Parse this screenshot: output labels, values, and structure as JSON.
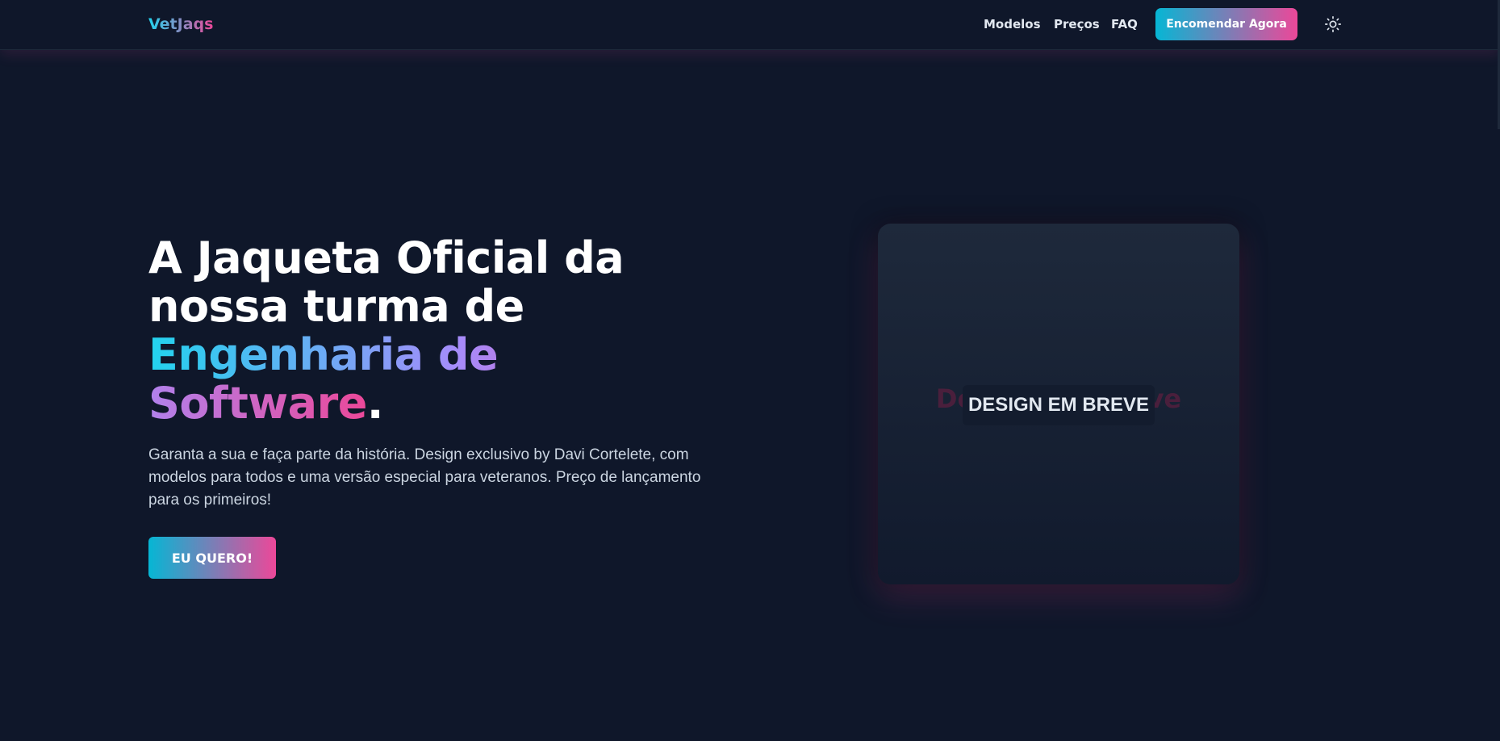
{
  "nav": {
    "logo": "VetJaqs",
    "links": [
      "Modelos",
      "Preços",
      "FAQ"
    ],
    "cta_label": "Encomendar Agora",
    "theme_icon": "sun-icon"
  },
  "hero": {
    "title_part1": "A Jaqueta Oficial da nossa turma de",
    "title_highlight": "Engenharia de Software",
    "title_end": ".",
    "description": "Garanta a sua e faça parte da história. Design exclusivo by Davi Cortelete, com modelos para todos e uma versão especial para veteranos. Preço de lançamento para os primeiros!",
    "cta_label": "EU QUERO!"
  },
  "preview": {
    "ghost_text": "Design em breve",
    "badge": "DESIGN EM BREVE"
  },
  "colors": {
    "background": "#0f172a",
    "accent_start": "#06b6d4",
    "accent_end": "#ec4899"
  }
}
